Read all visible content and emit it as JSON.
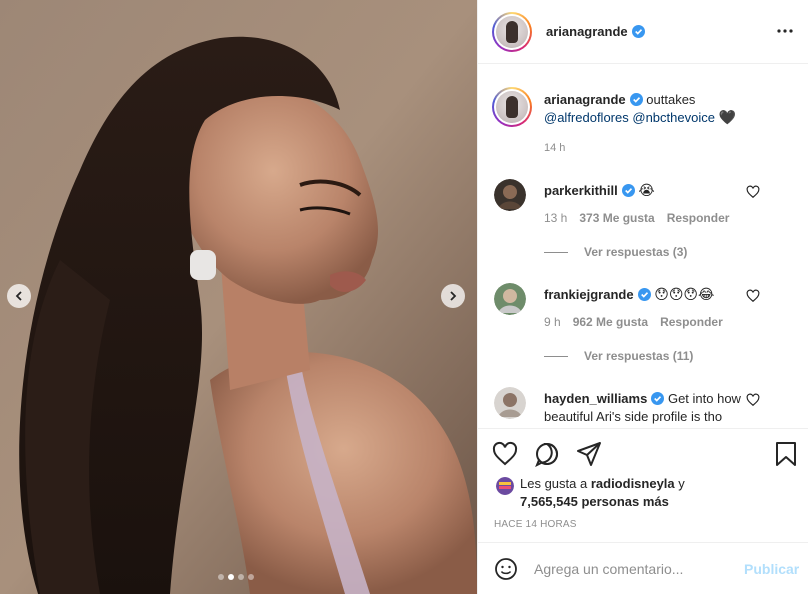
{
  "post_author": {
    "username": "arianagrande",
    "verified": true
  },
  "caption": {
    "username": "arianagrande",
    "text": "outtakes",
    "mentions": [
      "@alfredoflores",
      "@nbcthevoice"
    ],
    "emoji": "🖤",
    "time": "14 h"
  },
  "comments": [
    {
      "username": "parkerkithill",
      "verified": true,
      "text": "😭",
      "time": "13 h",
      "likes": "373 Me gusta",
      "reply_label": "Responder",
      "replies_label": "Ver respuestas (3)"
    },
    {
      "username": "frankiejgrande",
      "verified": true,
      "text": "😯😯😯😂",
      "time": "9 h",
      "likes": "962 Me gusta",
      "reply_label": "Responder",
      "replies_label": "Ver respuestas (11)"
    },
    {
      "username": "hayden_williams",
      "verified": true,
      "text": "Get into how beautiful Ari's side profile is tho"
    }
  ],
  "likes": {
    "prefix": "Les gusta a",
    "user": "radiodisneyla",
    "conj": "y",
    "others": "7,565,545 personas más"
  },
  "timestamp_label": "HACE 14 HORAS",
  "add_comment": {
    "placeholder": "Agrega un comentario...",
    "publish_label": "Publicar"
  },
  "carousel": {
    "count": 4,
    "active_index": 1
  },
  "colors": {
    "verified": "#3897f0",
    "link": "#00376b",
    "publish_disabled": "#b2dffc",
    "muted": "#8e8e8e"
  },
  "icons": [
    "chevron-left-icon",
    "chevron-right-icon",
    "more-icon",
    "heart-icon",
    "comment-icon",
    "share-icon",
    "bookmark-icon",
    "smile-icon",
    "verified-icon"
  ]
}
